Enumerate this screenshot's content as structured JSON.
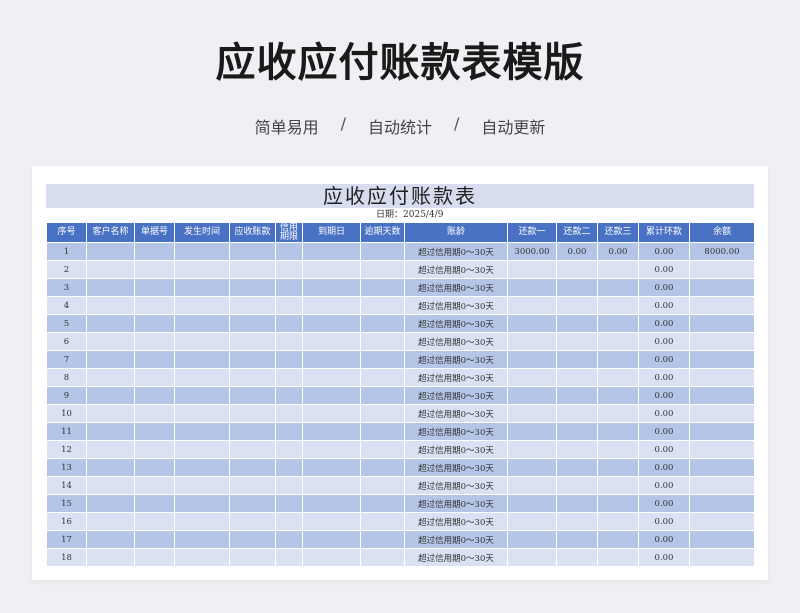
{
  "page": {
    "title": "应收应付账款表模版",
    "features": [
      "简单易用",
      "自动统计",
      "自动更新"
    ],
    "separator": "/"
  },
  "sheet": {
    "title": "应收应付账款表",
    "date_label": "日期：",
    "date_value": "2025/4/9",
    "columns": [
      "序号",
      "客户名称",
      "单据号",
      "发生时间",
      "应收账款",
      "信用期限",
      "到期日",
      "逾期天数",
      "账龄",
      "还款一",
      "还款二",
      "还款三",
      "累计环款",
      "余额"
    ],
    "rows": [
      [
        "1",
        "",
        "",
        "",
        "",
        "",
        "",
        "",
        "超过信用期0～30天",
        "3000.00",
        "0.00",
        "0.00",
        "0.00",
        "8000.00"
      ],
      [
        "2",
        "",
        "",
        "",
        "",
        "",
        "",
        "",
        "超过信用期0～30天",
        "",
        "",
        "",
        "0.00",
        ""
      ],
      [
        "3",
        "",
        "",
        "",
        "",
        "",
        "",
        "",
        "超过信用期0～30天",
        "",
        "",
        "",
        "0.00",
        ""
      ],
      [
        "4",
        "",
        "",
        "",
        "",
        "",
        "",
        "",
        "超过信用期0～30天",
        "",
        "",
        "",
        "0.00",
        ""
      ],
      [
        "5",
        "",
        "",
        "",
        "",
        "",
        "",
        "",
        "超过信用期0～30天",
        "",
        "",
        "",
        "0.00",
        ""
      ],
      [
        "6",
        "",
        "",
        "",
        "",
        "",
        "",
        "",
        "超过信用期0～30天",
        "",
        "",
        "",
        "0.00",
        ""
      ],
      [
        "7",
        "",
        "",
        "",
        "",
        "",
        "",
        "",
        "超过信用期0～30天",
        "",
        "",
        "",
        "0.00",
        ""
      ],
      [
        "8",
        "",
        "",
        "",
        "",
        "",
        "",
        "",
        "超过信用期0～30天",
        "",
        "",
        "",
        "0.00",
        ""
      ],
      [
        "9",
        "",
        "",
        "",
        "",
        "",
        "",
        "",
        "超过信用期0～30天",
        "",
        "",
        "",
        "0.00",
        ""
      ],
      [
        "10",
        "",
        "",
        "",
        "",
        "",
        "",
        "",
        "超过信用期0～30天",
        "",
        "",
        "",
        "0.00",
        ""
      ],
      [
        "11",
        "",
        "",
        "",
        "",
        "",
        "",
        "",
        "超过信用期0～30天",
        "",
        "",
        "",
        "0.00",
        ""
      ],
      [
        "12",
        "",
        "",
        "",
        "",
        "",
        "",
        "",
        "超过信用期0～30天",
        "",
        "",
        "",
        "0.00",
        ""
      ],
      [
        "13",
        "",
        "",
        "",
        "",
        "",
        "",
        "",
        "超过信用期0～30天",
        "",
        "",
        "",
        "0.00",
        ""
      ],
      [
        "14",
        "",
        "",
        "",
        "",
        "",
        "",
        "",
        "超过信用期0～30天",
        "",
        "",
        "",
        "0.00",
        ""
      ],
      [
        "15",
        "",
        "",
        "",
        "",
        "",
        "",
        "",
        "超过信用期0～30天",
        "",
        "",
        "",
        "0.00",
        ""
      ],
      [
        "16",
        "",
        "",
        "",
        "",
        "",
        "",
        "",
        "超过信用期0～30天",
        "",
        "",
        "",
        "0.00",
        ""
      ],
      [
        "17",
        "",
        "",
        "",
        "",
        "",
        "",
        "",
        "超过信用期0～30天",
        "",
        "",
        "",
        "0.00",
        ""
      ],
      [
        "18",
        "",
        "",
        "",
        "",
        "",
        "",
        "",
        "超过信用期0～30天",
        "",
        "",
        "",
        "0.00",
        ""
      ]
    ]
  },
  "colors": {
    "header_bg": "#4a72c4",
    "row_odd": "#b4c5e7",
    "row_even": "#d9e1f2",
    "title_band": "#d7ddee"
  }
}
